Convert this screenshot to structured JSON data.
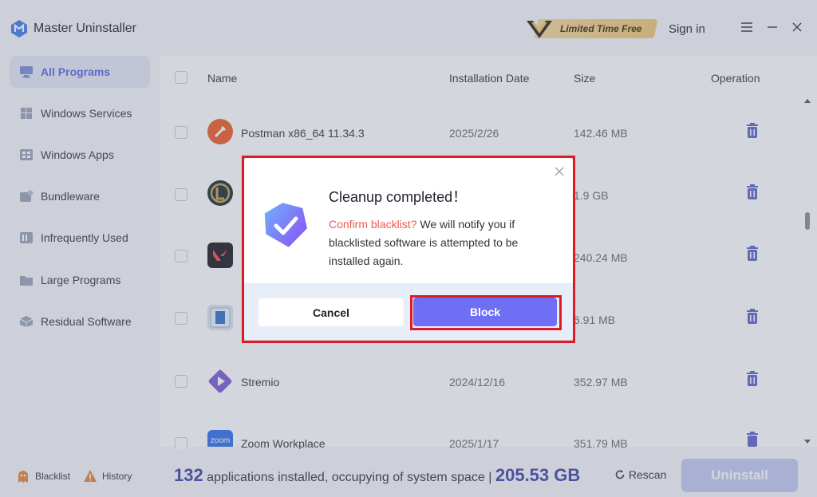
{
  "app": {
    "title": "Master Uninstaller",
    "promo_label": "Limited Time Free",
    "sign_in": "Sign in"
  },
  "sidebar": {
    "items": [
      {
        "label": "All Programs",
        "icon": "monitor-icon",
        "active": true
      },
      {
        "label": "Windows Services",
        "icon": "windows-icon",
        "active": false
      },
      {
        "label": "Windows Apps",
        "icon": "apps-grid-icon",
        "active": false
      },
      {
        "label": "Bundleware",
        "icon": "bundle-icon",
        "active": false
      },
      {
        "label": "Infrequently Used",
        "icon": "archive-icon",
        "active": false
      },
      {
        "label": "Large Programs",
        "icon": "folder-icon",
        "active": false
      },
      {
        "label": "Residual Software",
        "icon": "box-icon",
        "active": false
      }
    ]
  },
  "table": {
    "headers": {
      "name": "Name",
      "date": "Installation Date",
      "size": "Size",
      "operation": "Operation"
    },
    "rows": [
      {
        "name": "Postman x86_64 11.34.3",
        "date": "2025/2/26",
        "size": "142.46 MB",
        "icon": "postman-icon"
      },
      {
        "name": "",
        "date": "",
        "size": "1.9 GB",
        "icon": "league-icon"
      },
      {
        "name": "",
        "date": "",
        "size": "240.24 MB",
        "icon": "valorant-icon"
      },
      {
        "name": "",
        "date": "",
        "size": "6.91 MB",
        "icon": "app-window-icon"
      },
      {
        "name": "Stremio",
        "date": "2024/12/16",
        "size": "352.97 MB",
        "icon": "stremio-icon"
      },
      {
        "name": "Zoom Workplace",
        "date": "2025/1/17",
        "size": "351.79 MB",
        "icon": "zoom-icon",
        "icon_text": "zoom"
      }
    ]
  },
  "footer": {
    "blacklist": "Blacklist",
    "history": "History",
    "count": "132",
    "summary_text": "applications installed, occupying of system space |",
    "space": "205.53 GB",
    "rescan": "Rescan",
    "uninstall": "Uninstall"
  },
  "dialog": {
    "title": "Cleanup completed！",
    "confirm": "Confirm blacklist?",
    "message": "We will notify you if blacklisted software is attempted to be installed again.",
    "cancel": "Cancel",
    "block": "Block"
  },
  "colors": {
    "accent": "#6f6ff6",
    "highlight": "#e01a22",
    "confirm": "#ef5a4c"
  }
}
